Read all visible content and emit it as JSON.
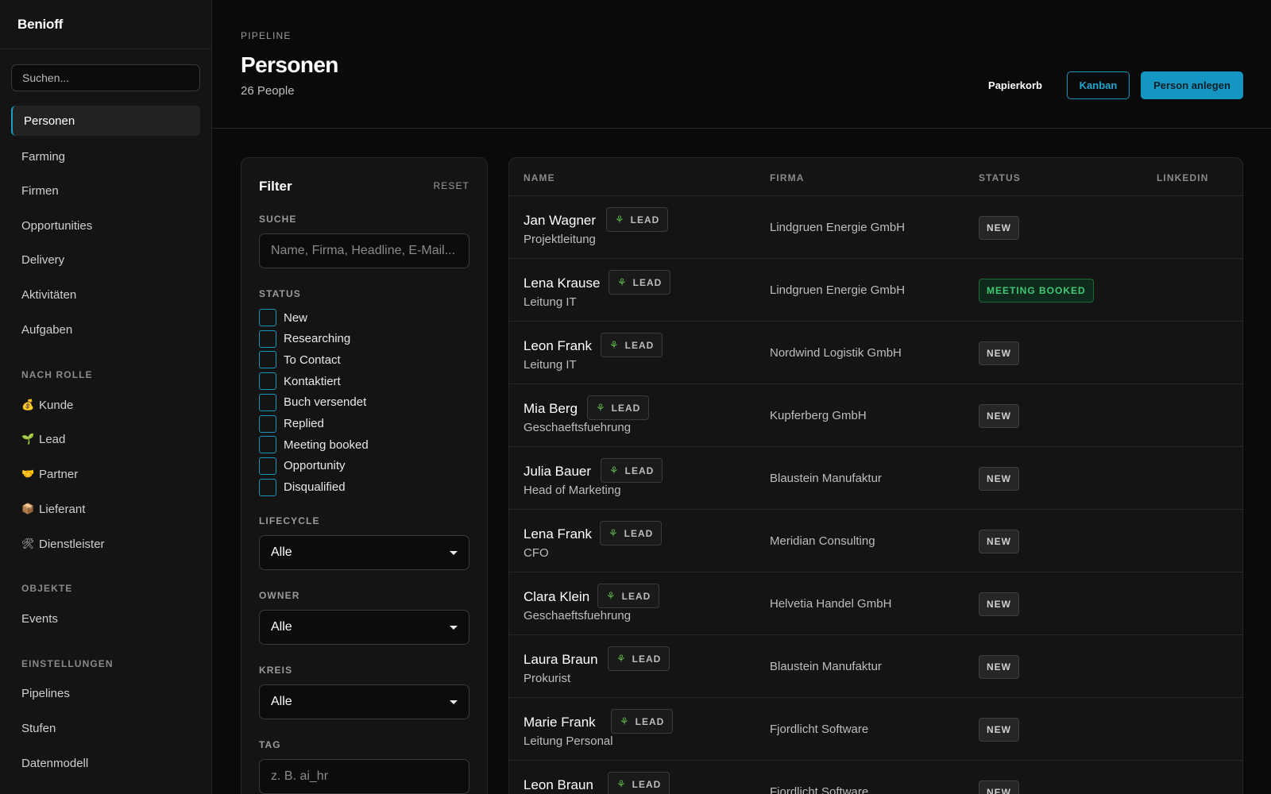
{
  "app": {
    "brand": "Benioff"
  },
  "sidebar": {
    "search_placeholder": "Suchen...",
    "main_items": [
      {
        "label": "Personen",
        "active": true
      },
      {
        "label": "Farming"
      },
      {
        "label": "Firmen"
      },
      {
        "label": "Opportunities"
      },
      {
        "label": "Delivery"
      },
      {
        "label": "Aktivitäten"
      },
      {
        "label": "Aufgaben"
      }
    ],
    "section_role": "NACH ROLLE",
    "role_items": [
      {
        "emoji": "💰",
        "label": "Kunde"
      },
      {
        "emoji": "🌱",
        "label": "Lead"
      },
      {
        "emoji": "🤝",
        "label": "Partner"
      },
      {
        "emoji": "📦",
        "label": "Lieferant"
      },
      {
        "emoji": "🛠",
        "label": "Dienstleister"
      }
    ],
    "section_objects": "OBJEKTE",
    "object_items": [
      {
        "label": "Events"
      }
    ],
    "section_settings": "EINSTELLUNGEN",
    "settings_items": [
      {
        "label": "Pipelines"
      },
      {
        "label": "Stufen"
      },
      {
        "label": "Datenmodell"
      }
    ]
  },
  "header": {
    "breadcrumb": "PIPELINE",
    "title": "Personen",
    "count": "26 People",
    "trash_label": "Papierkorb",
    "kanban_label": "Kanban",
    "create_label": "Person anlegen"
  },
  "filter": {
    "title": "Filter",
    "reset": "RESET",
    "search_label": "SUCHE",
    "search_placeholder": "Name, Firma, Headline, E-Mail...",
    "status_label": "STATUS",
    "status_options": [
      "New",
      "Researching",
      "To Contact",
      "Kontaktiert",
      "Buch versendet",
      "Replied",
      "Meeting booked",
      "Opportunity",
      "Disqualified"
    ],
    "lifecycle_label": "LIFECYCLE",
    "lifecycle_value": "Alle",
    "owner_label": "OWNER",
    "owner_value": "Alle",
    "kreis_label": "KREIS",
    "kreis_value": "Alle",
    "tag_label": "TAG",
    "tag_placeholder": "z. B. ai_hr"
  },
  "table": {
    "columns": [
      "NAME",
      "FIRMA",
      "STATUS",
      "LINKEDIN"
    ],
    "badge_label": "LEAD",
    "rows": [
      {
        "name": "Jan Wagner",
        "title": "Projektleitung",
        "firma": "Lindgruen Energie GmbH",
        "status": "NEW",
        "kind": "new"
      },
      {
        "name": "Lena Krause",
        "title": "Leitung IT",
        "firma": "Lindgruen Energie GmbH",
        "status": "MEETING BOOKED",
        "kind": "meeting"
      },
      {
        "name": "Leon Frank",
        "title": "Leitung IT",
        "firma": "Nordwind Logistik GmbH",
        "status": "NEW",
        "kind": "new"
      },
      {
        "name": "Mia Berg",
        "title": "Geschaeftsfuehrung",
        "firma": "Kupferberg GmbH",
        "status": "NEW",
        "kind": "new"
      },
      {
        "name": "Julia Bauer",
        "title": "Head of Marketing",
        "firma": "Blaustein Manufaktur",
        "status": "NEW",
        "kind": "new"
      },
      {
        "name": "Lena Frank",
        "title": "CFO",
        "firma": "Meridian Consulting",
        "status": "NEW",
        "kind": "new"
      },
      {
        "name": "Clara Klein",
        "title": "Geschaeftsfuehrung",
        "firma": "Helvetia Handel GmbH",
        "status": "NEW",
        "kind": "new"
      },
      {
        "name": "Laura Braun",
        "title": "Prokurist",
        "firma": "Blaustein Manufaktur",
        "status": "NEW",
        "kind": "new"
      },
      {
        "name": "Marie Frank",
        "title": "Leitung Personal",
        "firma": "Fjordlicht Software",
        "status": "NEW",
        "kind": "new"
      },
      {
        "name": "Leon Braun",
        "title": "",
        "firma": "Fjordlicht Software",
        "status": "NEW",
        "kind": "new"
      }
    ]
  }
}
